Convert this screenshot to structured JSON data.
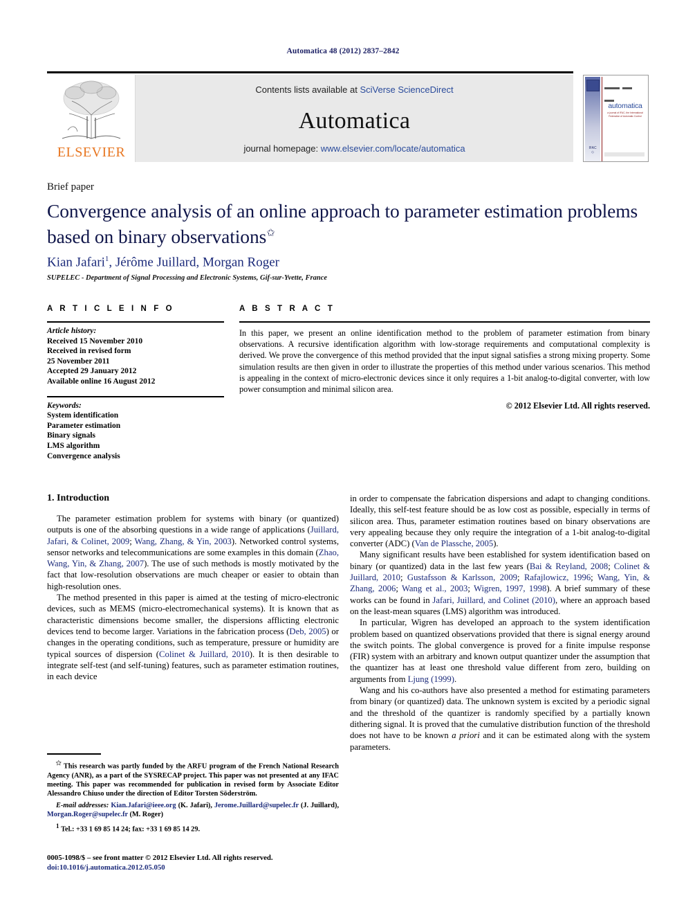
{
  "running_head": "Automatica 48 (2012) 2837–2842",
  "masthead": {
    "publisher_logo_label": "ELSEVIER",
    "contents_prefix": "Contents lists available at ",
    "contents_link": "SciVerse ScienceDirect",
    "journal_title": "Automatica",
    "homepage_prefix": "journal homepage: ",
    "homepage_link": "www.elsevier.com/locate/automatica"
  },
  "cover": {
    "brand": "automatica",
    "subtitle": "a journal of IFAC, the International\nFederation of Automatic Control",
    "ifac_mark": "IFAC"
  },
  "article": {
    "type_label": "Brief paper",
    "title": "Convergence analysis of an online approach to parameter estimation problems based on binary observations",
    "title_marker": "✩",
    "authors": "Kian Jafari 1, Jérôme Juillard, Morgan Roger",
    "authors_parts": [
      {
        "name": "Kian Jafari",
        "sup": "1"
      },
      {
        "name": "Jérôme Juillard",
        "sup": ""
      },
      {
        "name": "Morgan Roger",
        "sup": ""
      }
    ],
    "affiliation": "SUPELEC - Department of Signal Processing and Electronic Systems, Gif-sur-Yvette, France"
  },
  "article_info": {
    "heading": "A R T I C L E   I N F O",
    "history_label": "Article history:",
    "history": [
      "Received 15 November 2010",
      "Received in revised form",
      "25 November 2011",
      "Accepted 29 January 2012",
      "Available online 16 August 2012"
    ],
    "keywords_label": "Keywords:",
    "keywords": [
      "System identification",
      "Parameter estimation",
      "Binary signals",
      "LMS algorithm",
      "Convergence analysis"
    ]
  },
  "abstract": {
    "heading": "A B S T R A C T",
    "text": "In this paper, we present an online identification method to the problem of parameter estimation from binary observations. A recursive identification algorithm with low-storage requirements and computational complexity is derived. We prove the convergence of this method provided that the input signal satisfies a strong mixing property. Some simulation results are then given in order to illustrate the properties of this method under various scenarios. This method is appealing in the context of micro-electronic devices since it only requires a 1-bit analog-to-digital converter, with low power consumption and minimal silicon area.",
    "copyright": "© 2012 Elsevier Ltd. All rights reserved."
  },
  "body": {
    "section_title": "1. Introduction",
    "left_paragraphs": [
      "The parameter estimation problem for systems with binary (or quantized) outputs is one of the absorbing questions in a wide range of applications (Juillard, Jafari, & Colinet, 2009; Wang, Zhang, & Yin, 2003). Networked control systems, sensor networks and telecommunications are some examples in this domain (Zhao, Wang, Yin, & Zhang, 2007). The use of such methods is mostly motivated by the fact that low-resolution observations are much cheaper or easier to obtain than high-resolution ones.",
      "The method presented in this paper is aimed at the testing of micro-electronic devices, such as MEMS (micro-electromechanical systems). It is known that as characteristic dimensions become smaller, the dispersions afflicting electronic devices tend to become larger. Variations in the fabrication process (Deb, 2005) or changes in the operating conditions, such as temperature, pressure or humidity are typical sources of dispersion (Colinet & Juillard, 2010). It is then desirable to integrate self-test (and self-tuning) features, such as parameter estimation routines, in each device"
    ],
    "right_paragraphs": [
      "in order to compensate the fabrication dispersions and adapt to changing conditions. Ideally, this self-test feature should be as low cost as possible, especially in terms of silicon area. Thus, parameter estimation routines based on binary observations are very appealing because they only require the integration of a 1-bit analog-to-digital converter (ADC) (Van de Plassche, 2005).",
      "Many significant results have been established for system identification based on binary (or quantized) data in the last few years (Bai & Reyland, 2008; Colinet & Juillard, 2010; Gustafsson & Karlsson, 2009; Rafajlowicz, 1996; Wang, Yin, & Zhang, 2006; Wang et al., 2003; Wigren, 1997, 1998). A brief summary of these works can be found in Jafari, Juillard, and Colinet (2010), where an approach based on the least-mean squares (LMS) algorithm was introduced.",
      "In particular, Wigren has developed an approach to the system identification problem based on quantized observations provided that there is signal energy around the switch points. The global convergence is proved for a finite impulse response (FIR) system with an arbitrary and known output quantizer under the assumption that the quantizer has at least one threshold value different from zero, building on arguments from Ljung (1999).",
      "Wang and his co-authors have also presented a method for estimating parameters from binary (or quantized) data. The unknown system is excited by a periodic signal and the threshold of the quantizer is randomly specified by a partially known dithering signal. It is proved that the cumulative distribution function of the threshold does not have to be known a priori and it can be estimated along with the system parameters."
    ]
  },
  "footnotes": {
    "funding": "This research was partly funded by the ARFU program of the French National Research Agency (ANR), as a part of the SYSRECAP project. This paper was not presented at any IFAC meeting. This paper was recommended for publication in revised form by Associate Editor Alessandro Chiuso under the direction of Editor Torsten Söderström.",
    "email_label": "E-mail addresses:",
    "emails": [
      {
        "address": "Kian.Jafari@ieee.org",
        "owner": "(K. Jafari)"
      },
      {
        "address": "Jerome.Juillard@supelec.fr",
        "owner": "(J. Juillard)"
      },
      {
        "address": "Morgan.Roger@supelec.fr",
        "owner": "(M. Roger)"
      }
    ],
    "tel_marker": "1",
    "tel": "Tel.: +33 1 69 85 14 24; fax: +33 1 69 85 14 29."
  },
  "colophon": {
    "line1": "0005-1098/$ – see front matter © 2012 Elsevier Ltd. All rights reserved.",
    "doi": "doi:10.1016/j.automatica.2012.05.050"
  },
  "colors": {
    "link_blue": "#2a4b9b",
    "citation_blue": "#1b2a7a",
    "title_navy": "#10164a",
    "elsevier_orange": "#e87722",
    "masthead_grey": "#e9e9e9"
  }
}
